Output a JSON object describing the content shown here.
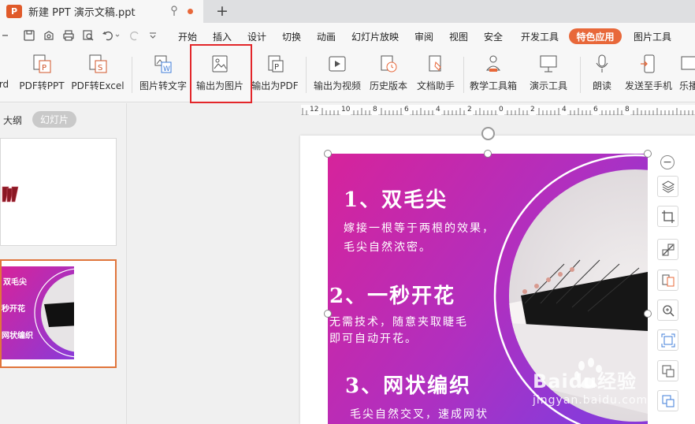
{
  "tab": {
    "title": "新建 PPT 演示文稿.ppt",
    "icon_letter": "P",
    "new_tab": "+"
  },
  "menu": {
    "items": [
      "开始",
      "插入",
      "设计",
      "切换",
      "动画",
      "幻灯片放映",
      "审阅",
      "视图",
      "安全",
      "开发工具"
    ],
    "special": "特色应用",
    "after_special": "图片工具"
  },
  "ribbon": {
    "partial_left": "rd",
    "buttons": [
      "PDF转PPT",
      "PDF转Excel",
      "图片转文字",
      "输出为图片",
      "输出为PDF",
      "输出为视频",
      "历史版本",
      "文档助手",
      "教学工具箱",
      "演示工具",
      "朗读",
      "发送至手机",
      "乐播"
    ]
  },
  "left_panel": {
    "outline": "大纲",
    "slides": "幻灯片"
  },
  "ruler": {
    "ticks": [
      "12",
      "10",
      "8",
      "6",
      "4",
      "2",
      "0",
      "2",
      "4",
      "6",
      "8"
    ]
  },
  "slide": {
    "heading1": "1、双毛尖",
    "body1a": "嫁接一根等于两根的效果，",
    "body1b": "毛尖自然浓密。",
    "heading2": "2、一秒开花",
    "body2a": "无需技术，随意夹取睫毛",
    "body2b": "即可自动开花。",
    "heading3": "3、网状编织",
    "body3a": "毛尖自然交叉，速成网状"
  },
  "thumb2": {
    "line1": "双毛尖",
    "line2": "秒开花",
    "line3": "网状编织"
  },
  "watermark": {
    "brand": "Baidu经验",
    "url": "jingyan.baidu.com"
  },
  "colors": {
    "accent": "#e8683a",
    "highlight_box": "#e3262a",
    "slide_grad_start": "#d6239b",
    "slide_grad_end": "#8a3ad8"
  }
}
